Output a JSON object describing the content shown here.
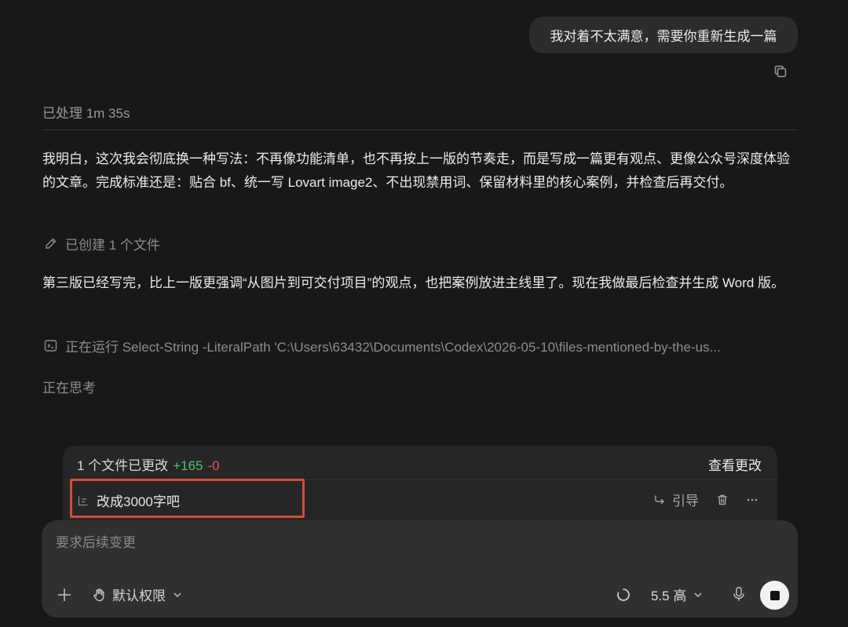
{
  "user_message": "我对着不太满意，需要你重新生成一篇",
  "processed_label": "已处理 1m 35s",
  "assistant_para1": "我明白，这次我会彻底换一种写法：不再像功能清单，也不再按上一版的节奏走，而是写成一篇更有观点、更像公众号深度体验的文章。完成标准还是：贴合 bf、统一写 Lovart image2、不出现禁用词、保留材料里的核心案例，并检查后再交付。",
  "created_file_label": "已创建 1 个文件",
  "assistant_para2": "第三版已经写完，比上一版更强调“从图片到可交付项目”的观点，也把案例放进主线里了。现在我做最后检查并生成 Word 版。",
  "running_label": "正在运行 Select-String -LiteralPath 'C:\\Users\\63432\\Documents\\Codex\\2026-05-10\\files-mentioned-by-the-us...",
  "thinking_label": "正在思考",
  "changes": {
    "summary": "1 个文件已更改",
    "added": "+165",
    "removed": "-0",
    "view_label": "查看更改"
  },
  "queued": {
    "text": "改成3000字吧",
    "steer_label": "引导"
  },
  "composer": {
    "placeholder": "要求后续变更",
    "permission_label": "默认权限",
    "model_label": "5.5 高"
  },
  "icons": {
    "copy": "copy-icon",
    "pencil": "pencil-icon",
    "terminal": "terminal-icon",
    "queue": "queue-icon",
    "steer": "steer-arrow-icon",
    "trash": "trash-icon",
    "more": "more-icon",
    "plus": "plus-icon",
    "hand": "hand-icon",
    "chevron": "chevron-down-icon",
    "spinner": "spinner-icon",
    "mic": "mic-icon",
    "stop": "stop-icon"
  },
  "colors": {
    "background": "#181818",
    "added": "#4fc26c",
    "removed": "#e0555a",
    "highlight": "#d84a38"
  }
}
